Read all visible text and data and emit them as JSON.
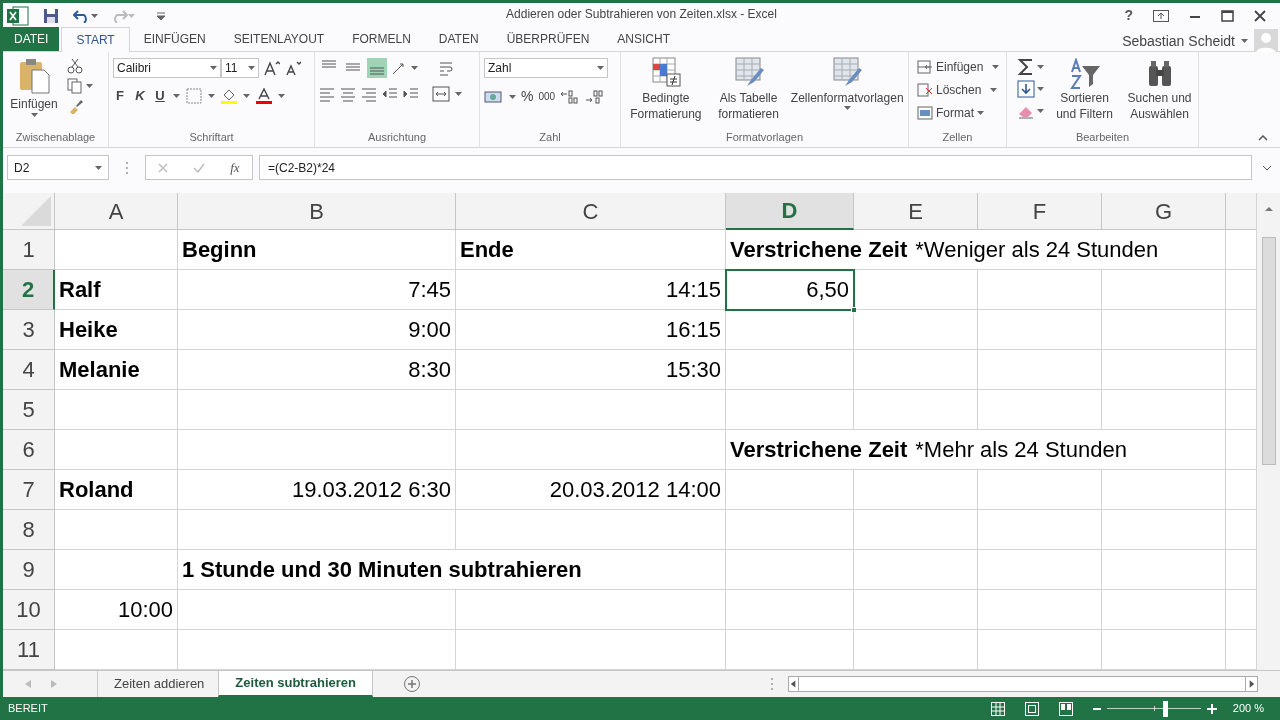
{
  "window": {
    "title": "Addieren oder Subtrahieren von Zeiten.xlsx - Excel",
    "help": "?"
  },
  "ribbon_tabs": [
    {
      "label": "DATEI",
      "kind": "file",
      "selected": false
    },
    {
      "label": "START",
      "kind": "tab",
      "selected": true
    },
    {
      "label": "EINFÜGEN",
      "kind": "tab",
      "selected": false
    },
    {
      "label": "SEITENLAYOUT",
      "kind": "tab",
      "selected": false
    },
    {
      "label": "FORMELN",
      "kind": "tab",
      "selected": false
    },
    {
      "label": "DATEN",
      "kind": "tab",
      "selected": false
    },
    {
      "label": "ÜBERPRÜFEN",
      "kind": "tab",
      "selected": false
    },
    {
      "label": "ANSICHT",
      "kind": "tab",
      "selected": false
    }
  ],
  "user": {
    "name": "Sebastian Scheidt"
  },
  "ribbon": {
    "groups": [
      {
        "kind": "clipboard",
        "label": "Zwischenablage",
        "paste": "Einfügen"
      },
      {
        "kind": "font",
        "label": "Schriftart",
        "font": "Calibri",
        "size": "11",
        "bold": "F",
        "italic": "K",
        "underline": "U"
      },
      {
        "kind": "alignment",
        "label": "Ausrichtung",
        "vertical_align": [
          {
            "selected": false
          },
          {
            "selected": false
          },
          {
            "selected": true
          }
        ]
      },
      {
        "kind": "number",
        "label": "Zahl",
        "format": "Zahl",
        "percent": "%",
        "thousands": "000"
      },
      {
        "kind": "styles",
        "label": "Formatvorlagen",
        "buttons": [
          "Bedingte Formatierung",
          "Als Tabelle formatieren",
          "Zellenformatvorlagen"
        ]
      },
      {
        "kind": "cells",
        "label": "Zellen",
        "buttons": [
          "Einfügen",
          "Löschen",
          "Format"
        ]
      },
      {
        "kind": "editing",
        "label": "Bearbeiten",
        "buttons": [
          "Sortieren und Filtern",
          "Suchen und Auswählen"
        ]
      }
    ]
  },
  "formula_bar": {
    "name_box": "D2",
    "fx": "fx",
    "formula": "=(C2-B2)*24"
  },
  "sheet": {
    "columns": [
      {
        "label": "A",
        "selected": false
      },
      {
        "label": "B",
        "selected": false
      },
      {
        "label": "C",
        "selected": false
      },
      {
        "label": "D",
        "selected": true
      },
      {
        "label": "E",
        "selected": false
      },
      {
        "label": "F",
        "selected": false
      },
      {
        "label": "G",
        "selected": false
      }
    ],
    "rows": [
      {
        "label": "1",
        "selected": false,
        "cells": [
          null,
          {
            "kind": "text",
            "selected": false,
            "runs": [
              {
                "text": "Beginn",
                "bold": true
              }
            ]
          },
          {
            "kind": "text",
            "selected": false,
            "runs": [
              {
                "text": "Ende",
                "bold": true
              }
            ]
          },
          {
            "kind": "text",
            "selected": false,
            "runs": [
              {
                "text": "Verstrichene Zeit",
                "bold": true
              },
              {
                "text": "*Weniger als 24 Stunden",
                "bold": false
              }
            ]
          },
          null,
          null,
          null
        ]
      },
      {
        "label": "2",
        "selected": true,
        "cells": [
          {
            "kind": "text",
            "selected": false,
            "runs": [
              {
                "text": "Ralf",
                "bold": true
              }
            ]
          },
          {
            "kind": "number",
            "selected": false,
            "runs": [
              {
                "text": "7:45",
                "bold": false
              }
            ]
          },
          {
            "kind": "number",
            "selected": false,
            "runs": [
              {
                "text": "14:15",
                "bold": false
              }
            ]
          },
          {
            "kind": "number",
            "selected": true,
            "runs": [
              {
                "text": "6,50",
                "bold": false
              }
            ]
          },
          null,
          null,
          null
        ]
      },
      {
        "label": "3",
        "selected": false,
        "cells": [
          {
            "kind": "text",
            "selected": false,
            "runs": [
              {
                "text": "Heike",
                "bold": true
              }
            ]
          },
          {
            "kind": "number",
            "selected": false,
            "runs": [
              {
                "text": "9:00",
                "bold": false
              }
            ]
          },
          {
            "kind": "number",
            "selected": false,
            "runs": [
              {
                "text": "16:15",
                "bold": false
              }
            ]
          },
          null,
          null,
          null,
          null
        ]
      },
      {
        "label": "4",
        "selected": false,
        "cells": [
          {
            "kind": "text",
            "selected": false,
            "runs": [
              {
                "text": "Melanie",
                "bold": true
              }
            ]
          },
          {
            "kind": "number",
            "selected": false,
            "runs": [
              {
                "text": "8:30",
                "bold": false
              }
            ]
          },
          {
            "kind": "number",
            "selected": false,
            "runs": [
              {
                "text": "15:30",
                "bold": false
              }
            ]
          },
          null,
          null,
          null,
          null
        ]
      },
      {
        "label": "5",
        "selected": false
      },
      {
        "label": "6",
        "selected": false,
        "cells": [
          null,
          null,
          null,
          {
            "kind": "text",
            "selected": false,
            "runs": [
              {
                "text": "Verstrichene Zeit",
                "bold": true
              },
              {
                "text": "*Mehr als 24 Stunden",
                "bold": false
              }
            ]
          },
          null,
          null,
          null
        ]
      },
      {
        "label": "7",
        "selected": false,
        "cells": [
          {
            "kind": "text",
            "selected": false,
            "runs": [
              {
                "text": "Roland",
                "bold": true
              }
            ]
          },
          {
            "kind": "number",
            "selected": false,
            "runs": [
              {
                "text": "19.03.2012 6:30",
                "bold": false
              }
            ]
          },
          {
            "kind": "number",
            "selected": false,
            "runs": [
              {
                "text": "20.03.2012 14:00",
                "bold": false
              }
            ]
          },
          null,
          null,
          null,
          null
        ]
      },
      {
        "label": "8",
        "selected": false
      },
      {
        "label": "9",
        "selected": false,
        "cells": [
          null,
          {
            "kind": "text",
            "selected": false,
            "runs": [
              {
                "text": "1 Stunde und 30 Minuten subtrahieren",
                "bold": true
              }
            ]
          },
          null,
          null,
          null,
          null,
          null
        ]
      },
      {
        "label": "10",
        "selected": false,
        "cells": [
          {
            "kind": "number",
            "selected": false,
            "runs": [
              {
                "text": "10:00",
                "bold": false
              }
            ]
          },
          null,
          null,
          null,
          null,
          null,
          null
        ]
      },
      {
        "label": "11",
        "selected": false
      }
    ]
  },
  "sheet_tabs": [
    {
      "label": "Zeiten addieren",
      "selected": false
    },
    {
      "label": "Zeiten subtrahieren",
      "selected": true
    }
  ],
  "status_bar": {
    "text": "BEREIT",
    "zoom": {
      "level": 0.62
    },
    "zoom_label": "200 %"
  }
}
